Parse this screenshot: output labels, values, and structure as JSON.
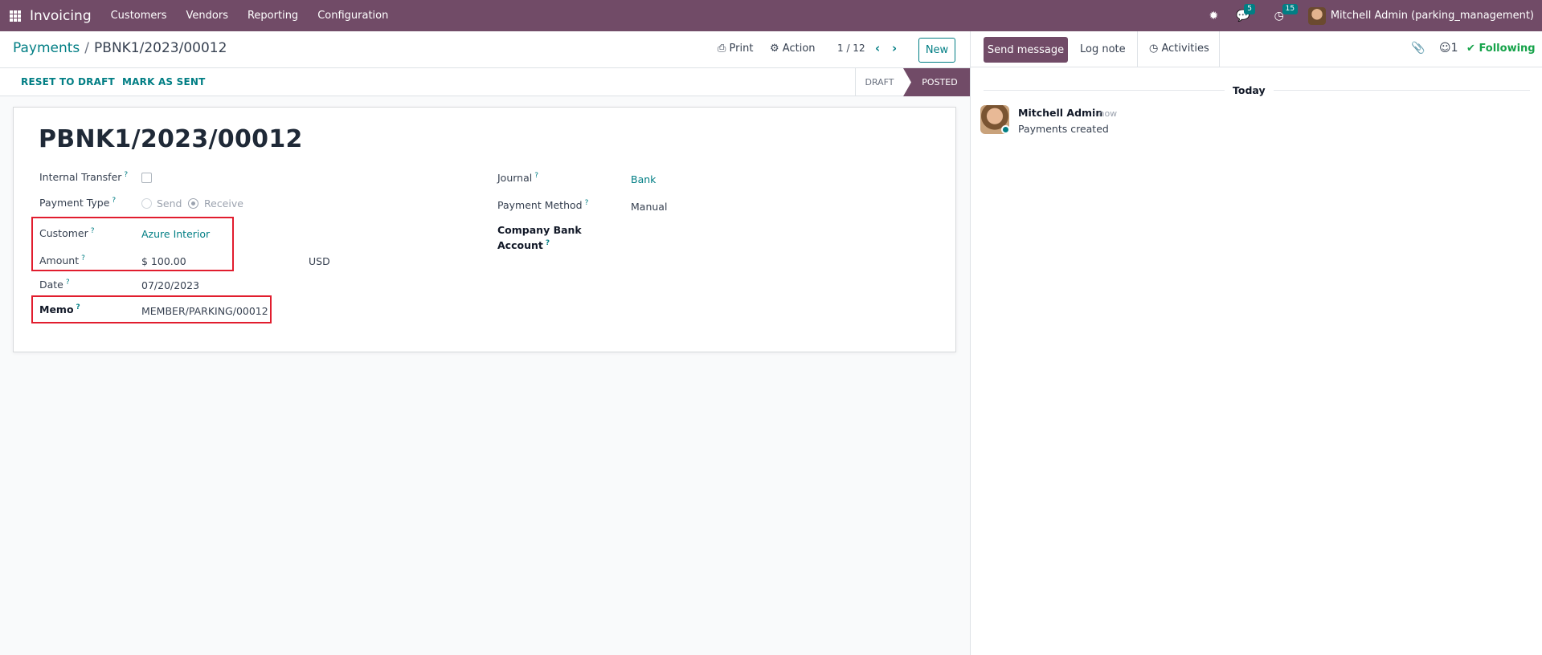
{
  "navbar": {
    "brand": "Invoicing",
    "menu": [
      "Customers",
      "Vendors",
      "Reporting",
      "Configuration"
    ],
    "messages_count": "5",
    "activities_count": "15",
    "user": "Mitchell Admin (parking_management)"
  },
  "control": {
    "breadcrumb_parent": "Payments",
    "breadcrumb_sep": "/",
    "breadcrumb_current": "PBNK1/2023/00012",
    "print": "Print",
    "action": "Action",
    "pager": "1 / 12",
    "new": "New"
  },
  "statusbar": {
    "reset_to_draft": "RESET TO DRAFT",
    "mark_as_sent": "MARK AS SENT",
    "stage_draft": "DRAFT",
    "stage_posted": "POSTED"
  },
  "form": {
    "title": "PBNK1/2023/00012",
    "help": "?",
    "internal_transfer_label": "Internal Transfer",
    "payment_type_label": "Payment Type",
    "payment_type_send": "Send",
    "payment_type_receive": "Receive",
    "customer_label": "Customer",
    "customer_value": "Azure Interior",
    "amount_label": "Amount",
    "amount_value": "$ 100.00",
    "currency": "USD",
    "date_label": "Date",
    "date_value": "07/20/2023",
    "memo_label": "Memo",
    "memo_value": "MEMBER/PARKING/00012",
    "journal_label": "Journal",
    "journal_value": "Bank",
    "payment_method_label": "Payment Method",
    "payment_method_value": "Manual",
    "company_bank_label_1": "Company Bank",
    "company_bank_label_2": "Account"
  },
  "chatter": {
    "send_message": "Send message",
    "log_note": "Log note",
    "activities": "Activities",
    "followers_count": "1",
    "following": "Following",
    "today": "Today",
    "author": "Mitchell Admin",
    "time": "- now",
    "message": "Payments created"
  },
  "colors": {
    "brand": "#714B67",
    "accent": "#017e84",
    "highlight": "#e11d2e",
    "following": "#16a34a"
  }
}
